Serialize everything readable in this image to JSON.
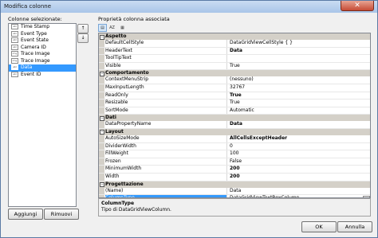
{
  "window": {
    "title": "Modifica colonne",
    "close_glyph": "✕"
  },
  "left": {
    "label": "Colonne selezionate:",
    "items": [
      {
        "icon": "abl",
        "label": "Time Stamp"
      },
      {
        "icon": "abl",
        "label": "Event Type"
      },
      {
        "icon": "abl",
        "label": "Event State"
      },
      {
        "icon": "abl",
        "label": "Camera ID"
      },
      {
        "icon": "img",
        "label": "Trace Image"
      },
      {
        "icon": "img",
        "label": "Trace Image"
      },
      {
        "icon": "abl",
        "label": "Data",
        "selected": true
      },
      {
        "icon": "abl",
        "label": "Event ID"
      }
    ],
    "move_up_glyph": "↑",
    "move_down_glyph": "↓",
    "add_label": "Aggiungi",
    "remove_label": "Rimuovi"
  },
  "right": {
    "label": "Proprietà colonna associata",
    "categories": [
      {
        "name": "Aspetto",
        "rows": [
          {
            "name": "DefaultCellStyle",
            "value": "DataGridViewCellStyle { }"
          },
          {
            "name": "HeaderText",
            "value": "Data",
            "bold": true
          },
          {
            "name": "ToolTipText",
            "value": ""
          },
          {
            "name": "Visible",
            "value": "True"
          }
        ]
      },
      {
        "name": "Comportamento",
        "rows": [
          {
            "name": "ContextMenuStrip",
            "value": "(nessuno)"
          },
          {
            "name": "MaxInputLength",
            "value": "32767"
          },
          {
            "name": "ReadOnly",
            "value": "True",
            "bold": true
          },
          {
            "name": "Resizable",
            "value": "True"
          },
          {
            "name": "SortMode",
            "value": "Automatic"
          }
        ]
      },
      {
        "name": "Dati",
        "rows": [
          {
            "name": "DataPropertyName",
            "value": "Data",
            "bold": true
          }
        ]
      },
      {
        "name": "Layout",
        "rows": [
          {
            "name": "AutoSizeMode",
            "value": "AllCellsExceptHeader",
            "bold": true
          },
          {
            "name": "DividerWidth",
            "value": "0"
          },
          {
            "name": "FillWeight",
            "value": "100"
          },
          {
            "name": "Frozen",
            "value": "False"
          },
          {
            "name": "MinimumWidth",
            "value": "200",
            "bold": true
          },
          {
            "name": "Width",
            "value": "200",
            "bold": true
          }
        ]
      },
      {
        "name": "Progettazione",
        "rows": [
          {
            "name": "(Name)",
            "value": "Data"
          },
          {
            "name": "ColumnType",
            "value": "DataGridViewTextBoxColumn",
            "selected": true,
            "dropdown": true
          }
        ]
      }
    ],
    "description": {
      "title": "ColumnType",
      "text": "Tipo di DataGridViewColumn."
    }
  },
  "footer": {
    "ok_label": "OK",
    "cancel_label": "Annulla"
  },
  "colors": {
    "selection": "#3399ff",
    "category_bg": "#d4d0c8",
    "title_bg": "#b9d1ee",
    "close_bg": "#c64b35"
  }
}
